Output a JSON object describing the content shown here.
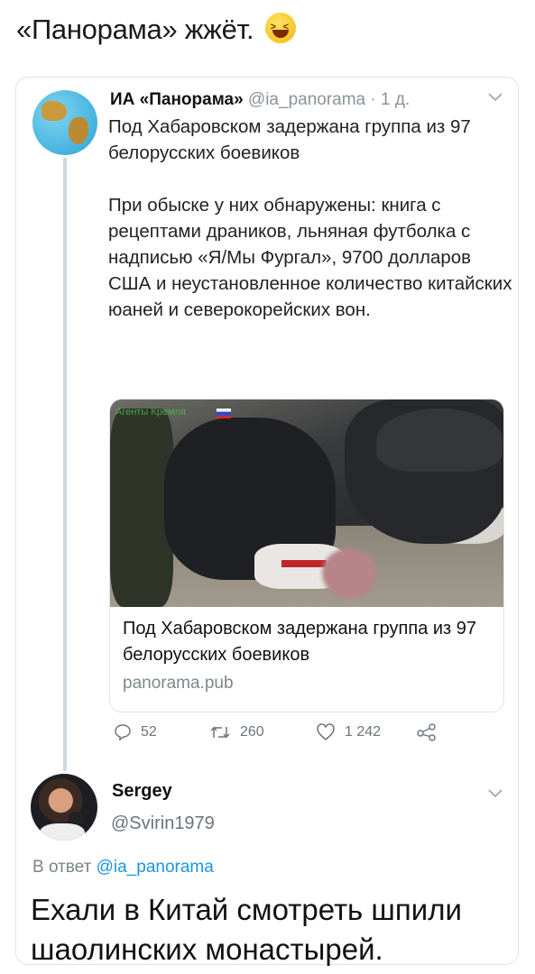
{
  "post": {
    "title": "«Панорама» жжёт.",
    "emoji": "laughing-face"
  },
  "tweet": {
    "author_name": "ИА «Панорама»",
    "handle": "@ia_panorama",
    "separator": "·",
    "time": "1 д.",
    "paragraph1": "Под Хабаровском задержана группа из 97 белорусских боевиков",
    "paragraph2": "При обыске у них обнаружены: книга с рецептами драников, льняная футболка с надписью «Я/Мы Фургал», 9700 долларов США и неустановленное количество китайских юаней и северокорейских вон."
  },
  "link_card": {
    "watermark": "Агенты Кремля",
    "title": "Под Хабаровском задержана группа из 97 белорусских боевиков",
    "domain": "panorama.pub"
  },
  "actions": {
    "replies": "52",
    "retweets": "260",
    "likes": "1 242"
  },
  "reply": {
    "name": "Sergey",
    "handle": "@Svirin1979",
    "reply_prefix": "В ответ",
    "reply_mention": "@ia_panorama",
    "text": "Ехали в Китай смотреть шпили шаолинских монастырей."
  },
  "colors": {
    "link": "#1b95e0",
    "meta": "#8a9399",
    "border": "#dfe3e6"
  }
}
